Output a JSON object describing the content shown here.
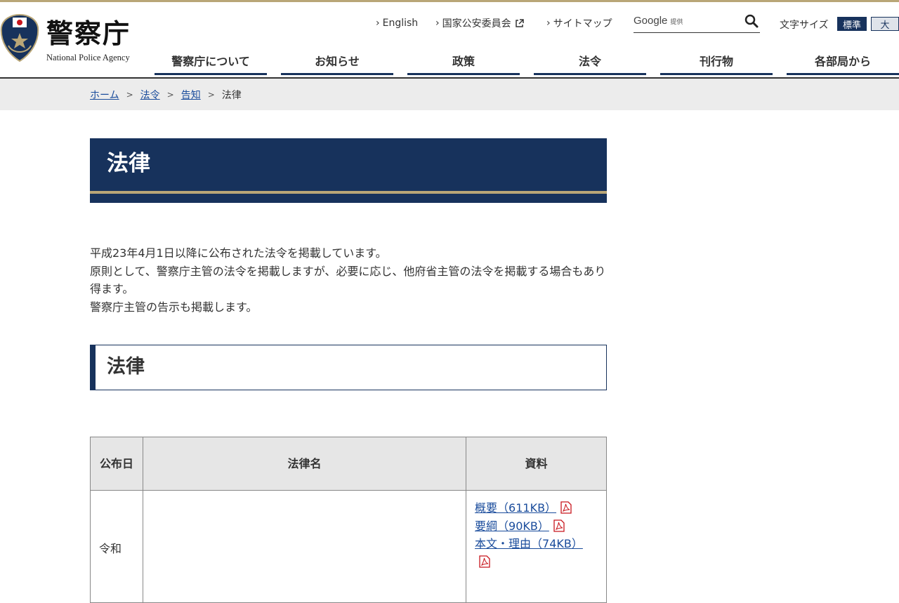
{
  "header": {
    "logo_title": "警察庁",
    "logo_subtitle": "National Police Agency",
    "util_links": {
      "english": "English",
      "commission": "国家公安委員会",
      "sitemap": "サイトマップ"
    },
    "search": {
      "google_label": "Google",
      "provided_label": "提供",
      "placeholder": ""
    },
    "font_size": {
      "label": "文字サイズ",
      "standard": "標準",
      "large": "大"
    },
    "nav": [
      {
        "label": "警察庁について"
      },
      {
        "label": "お知らせ"
      },
      {
        "label": "政策"
      },
      {
        "label": "法令"
      },
      {
        "label": "刊行物"
      },
      {
        "label": "各部局から"
      }
    ]
  },
  "breadcrumb": {
    "home": "ホーム",
    "laws": "法令",
    "notices": "告知",
    "current": "法律"
  },
  "main": {
    "page_title": "法律",
    "intro": [
      "平成23年4月1日以降に公布された法令を掲載しています。",
      "原則として、警察庁主管の法令を掲載しますが、必要に応じ、他府省主管の法令を掲載する場合もあり得ます。",
      "警察庁主管の告示も掲載します。"
    ],
    "section_title": "法律",
    "table": {
      "headers": {
        "date": "公布日",
        "name": "法律名",
        "docs": "資料"
      },
      "rows": [
        {
          "date": "令和",
          "name": "",
          "docs": [
            "概要（611KB）",
            "要綱（90KB）",
            "本文・理由（74KB）"
          ]
        }
      ]
    }
  },
  "colors": {
    "navy": "#17325c",
    "gold": "#b9a677",
    "link": "#1a4c9c",
    "breadcrumb_bg": "#ececec",
    "pdf_red": "#c8161d"
  }
}
